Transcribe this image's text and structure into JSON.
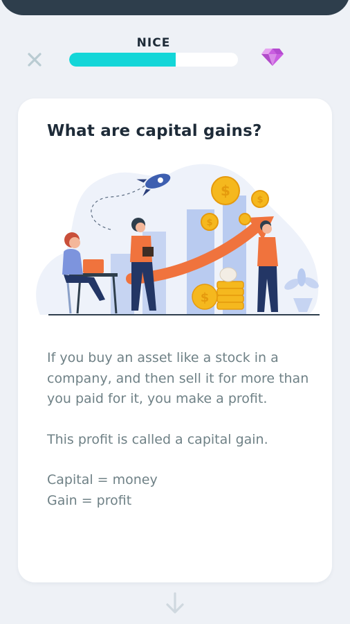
{
  "header": {
    "progress_label": "NICE",
    "progress_fraction": 0.63,
    "accent_color": "#14d6d8",
    "close_icon": "close-icon",
    "gem_icon": "gem-icon"
  },
  "card": {
    "title": "What are capital gains?",
    "illustration": "capital-gains-illustration",
    "paragraphs": [
      "If you buy an asset like a stock in a company, and then sell it for more than you paid for it, you make a profit.",
      "This profit is called a capital gain."
    ],
    "definitions": [
      "Capital = money",
      "Gain = profit"
    ]
  },
  "footer": {
    "next_icon": "arrow-down-icon"
  }
}
